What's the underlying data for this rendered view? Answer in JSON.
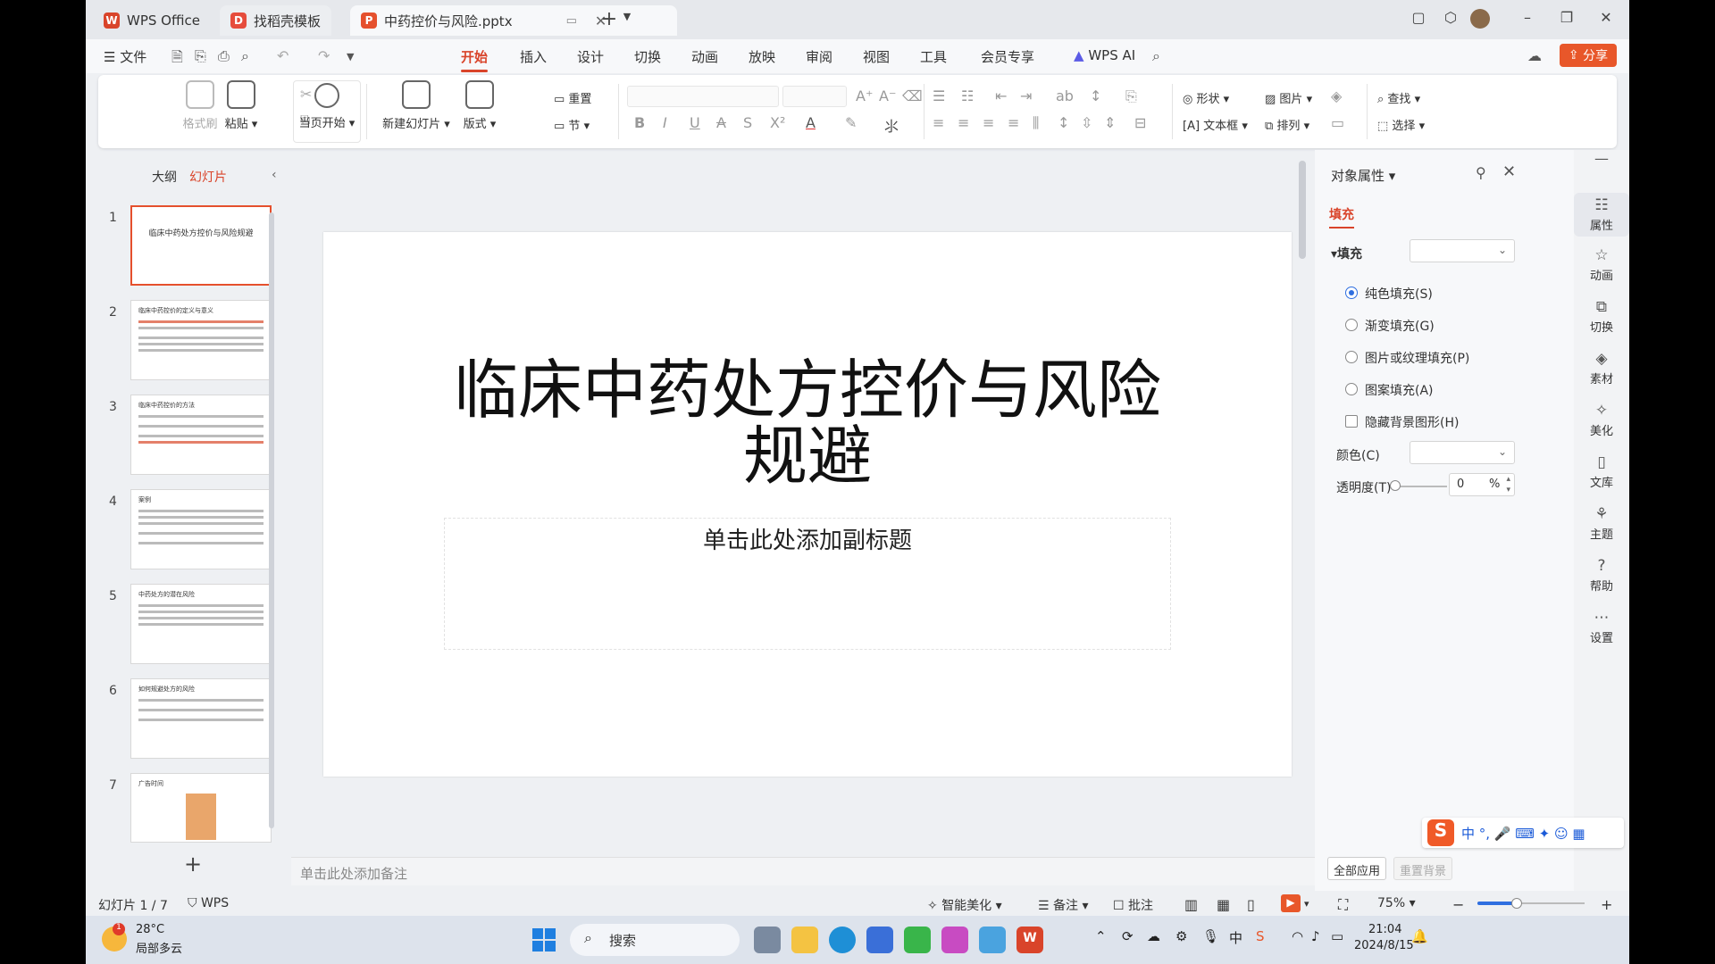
{
  "tabs": [
    {
      "label": "WPS Office"
    },
    {
      "label": "找稻壳模板"
    },
    {
      "label": "中药控价与风险.pptx"
    }
  ],
  "menu": {
    "file": "文件",
    "items": [
      "开始",
      "插入",
      "设计",
      "切换",
      "动画",
      "放映",
      "审阅",
      "视图",
      "工具",
      "会员专享"
    ],
    "wps_ai": "WPS AI",
    "share": "分享"
  },
  "ribbon": {
    "format_painter": "格式刷",
    "paste": "粘贴",
    "from_current": "当页开始",
    "new_slide": "新建幻灯片",
    "layout": "版式",
    "reset": "重置",
    "section": "节",
    "shape": "形状",
    "picture": "图片",
    "textbox": "文本框",
    "arrange": "排列",
    "find": "查找",
    "select": "选择"
  },
  "left_panel": {
    "outline": "大纲",
    "slides": "幻灯片"
  },
  "thumbnails": [
    {
      "num": "1",
      "title": "临床中药处方控价与风险规避"
    },
    {
      "num": "2",
      "title": "临床中药控价的定义与意义"
    },
    {
      "num": "3",
      "title": "临床中药控价的方法"
    },
    {
      "num": "4",
      "title": "案例"
    },
    {
      "num": "5",
      "title": "中药处方的潜在风险"
    },
    {
      "num": "6",
      "title": "如何规避处方的风险"
    },
    {
      "num": "7",
      "title": "广告时间"
    }
  ],
  "slide": {
    "title_line1": "临床中药处方控价与风险",
    "title_line2": "规避",
    "subtitle": "单击此处添加副标题"
  },
  "notes_placeholder": "单击此处添加备注",
  "right_panel": {
    "title": "对象属性",
    "tab_fill": "填充",
    "section_fill": "填充",
    "options": [
      "纯色填充(S)",
      "渐变填充(G)",
      "图片或纹理填充(P)",
      "图案填充(A)"
    ],
    "hide_bg": "隐藏背景图形(H)",
    "color_label": "颜色(C)",
    "transparency_label": "透明度(T)",
    "transparency_value": "0",
    "transparency_unit": "%",
    "apply_all": "全部应用",
    "reset_bg": "重置背景"
  },
  "rail": [
    {
      "label": "属性",
      "icon": "properties-icon"
    },
    {
      "label": "动画",
      "icon": "animation-icon"
    },
    {
      "label": "切换",
      "icon": "transition-icon"
    },
    {
      "label": "素材",
      "icon": "assets-icon"
    },
    {
      "label": "美化",
      "icon": "beautify-icon"
    },
    {
      "label": "文库",
      "icon": "library-icon"
    },
    {
      "label": "主题",
      "icon": "theme-icon"
    },
    {
      "label": "帮助",
      "icon": "help-icon"
    },
    {
      "label": "设置",
      "icon": "settings-icon"
    }
  ],
  "status": {
    "slide_count": "幻灯片 1 / 7",
    "wps": "WPS",
    "smart": "智能美化",
    "notes": "备注",
    "comments": "批注",
    "zoom": "75%"
  },
  "taskbar": {
    "temp": "28°C",
    "weather": "局部多云",
    "search": "搜索",
    "ime": "中",
    "time": "21:04",
    "date": "2024/8/15",
    "badge": "1"
  },
  "colors": {
    "accent": "#d9442a",
    "share": "#e8572a",
    "selected_radio": "#2f6fe0"
  }
}
